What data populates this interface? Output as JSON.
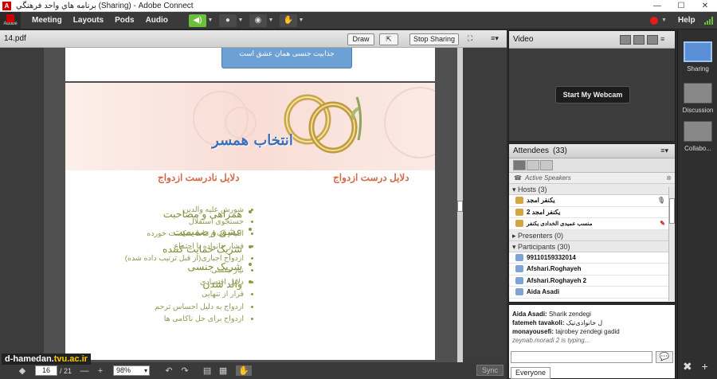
{
  "window": {
    "title": "برنامه هاي واحد فرهنگي (Sharing) - Adobe Connect",
    "minimize": "—",
    "maximize": "☐",
    "close": "✕"
  },
  "menubar": {
    "logo": "Adobe",
    "items": [
      "Meeting",
      "Layouts",
      "Pods",
      "Audio"
    ],
    "help": "Help"
  },
  "share_pod": {
    "title": "14.pdf",
    "draw_label": "Draw",
    "stop_sharing_label": "Stop Sharing",
    "menu_icon": "≡▾"
  },
  "prev_slide_text": "جذابیت جنسی همان عشق است",
  "slide": {
    "title": "انتخاب همسر",
    "col_right_heading": "دلایل درست ازدواج",
    "col_left_heading": "دلایل نادرست ازدواج",
    "right_items": [
      "همراهی و مصاحبت",
      "عشق و صمیمیت",
      "شریک حمایت کننده",
      "شریک جنسی",
      "والد شدن"
    ],
    "left_items": [
      "شورش علیه والدین",
      "جستجوی استقلال",
      "التیام یک ارتباط شکست خورده",
      "فشار خانواده یا اجتماع",
      "ازدواج اجباری(از قبل ترتیب داده شده)",
      "نیاز جنسی",
      "دلایل اقتصادی",
      "فرار از تنهایی",
      "ازدواج به دلیل احساس ترحم",
      "ازدواج برای حل ناکامی ها"
    ]
  },
  "viewer_bottom": {
    "page_current": "16",
    "page_total": "/ 21",
    "zoom": "98%",
    "sync_label": "Sync"
  },
  "watermark": {
    "main": "d-hamedan.",
    "accent": "tvu.ac.ir"
  },
  "video_pod": {
    "title": "Video",
    "webcam_button": "Start My Webcam"
  },
  "attendees": {
    "title": "Attendees",
    "count": "(33)",
    "active_speakers": "Active Speakers",
    "hosts_header": "▾ Hosts (3)",
    "hosts": [
      "یکنفر امجد",
      "یکنفر امجد 2",
      "منسب عمیدی الخدادی یکنفر"
    ],
    "presenters_header": "▸ Presenters (0)",
    "participants_header": "▾ Participants (30)",
    "participants": [
      "99110159332014",
      "Afshari.Roghayeh",
      "Afshari.Roghayeh 2",
      "Aida Asadi"
    ]
  },
  "chat": {
    "lines": [
      {
        "name": "Aida Asadi:",
        "text": " Sharik zendegi"
      },
      {
        "name": "fatemeh tavakoli:",
        "text": " ل خانوادی‌تیک"
      },
      {
        "name": "monayousefi:",
        "text": " tajrobey zendegi gadid"
      }
    ],
    "typing": "zeynab.moradi 2 is typing...",
    "tab_label": "Everyone"
  },
  "layouts_panel": {
    "items": [
      "Sharing",
      "Discussion",
      "Collabo..."
    ]
  },
  "colors": {
    "speaker_green": "#6cbf3c",
    "record_red": "#e21b1b",
    "title_blue": "#3d6fb8",
    "heading_orange": "#d36a45",
    "list_olive": "#7d8f32"
  }
}
